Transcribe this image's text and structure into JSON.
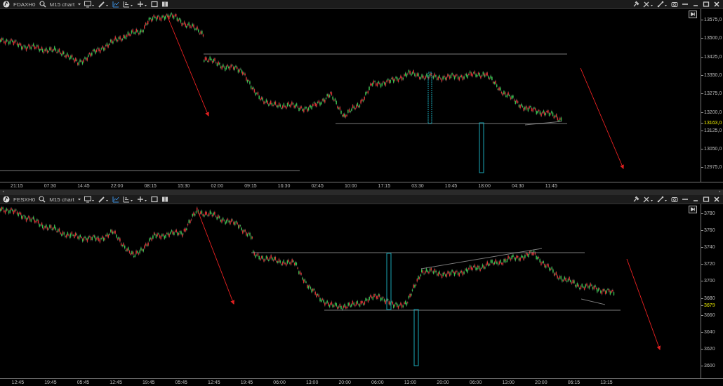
{
  "panels": [
    {
      "symbol": "FDAXH0",
      "timeframe": "M15 chart",
      "scrollbar": true,
      "price_labels": [
        "13575,0",
        "13500,0",
        "13425,0",
        "13350,0",
        "13275,0",
        "13200,0",
        "13125,0",
        "13050,0",
        "12975,0"
      ],
      "current_price": "13163,0",
      "time_labels": [
        "21:15",
        "07:30",
        "14:45",
        "22:00",
        "08:15",
        "15:30",
        "02:00",
        "09:15",
        "16:30",
        "02:45",
        "10:00",
        "17:15",
        "03:30",
        "10:45",
        "18:00",
        "04:30",
        "11:45"
      ]
    },
    {
      "symbol": "FESXH0",
      "timeframe": "M15 chart",
      "scrollbar": false,
      "price_labels": [
        "3780",
        "3760",
        "3740",
        "3720",
        "3700",
        "3680",
        "3660",
        "3640",
        "3620",
        "3600"
      ],
      "current_price": "3679",
      "time_labels": [
        "12:45",
        "19:45",
        "05:45",
        "12:45",
        "19:45",
        "05:45",
        "12:45",
        "19:45",
        "06:00",
        "13:00",
        "20:00",
        "06:00",
        "13:00",
        "20:00",
        "06:00",
        "13:00",
        "20:00",
        "06:15",
        "13:15"
      ]
    }
  ]
}
